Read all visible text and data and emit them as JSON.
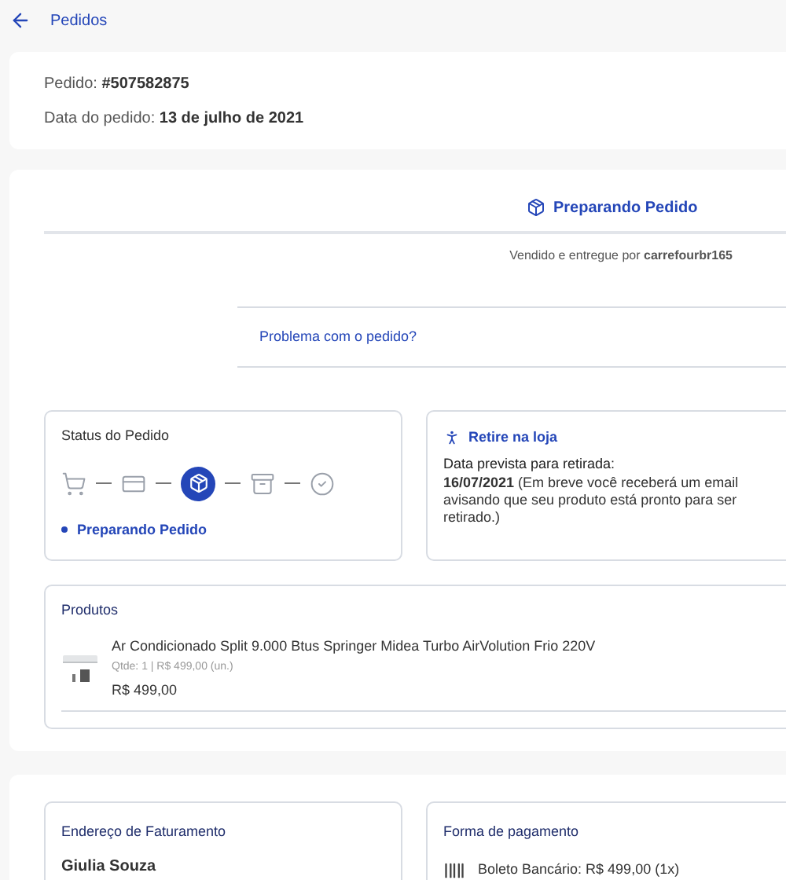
{
  "back_link": {
    "label": "Pedidos"
  },
  "order": {
    "number_label": "Pedido:",
    "number": "#507582875",
    "date_label": "Data do pedido:",
    "date": "13 de julho de 2021"
  },
  "shipment": {
    "status": "Preparando Pedido",
    "seller_text": "Vendido e entregue por **carrefourbr165**",
    "problem_link": "Problema com o pedido?"
  },
  "status_card": {
    "title": "Status do Pedido",
    "steps": [
      {
        "kind": "cart",
        "selected": false
      },
      {
        "kind": "payment",
        "selected": false
      },
      {
        "kind": "preparing",
        "selected": true
      },
      {
        "kind": "shipping",
        "selected": false
      },
      {
        "kind": "done",
        "selected": false
      }
    ],
    "current": "Preparando Pedido"
  },
  "pickup_card": {
    "title": "Retire na loja",
    "label": "Data prevista para retirada:",
    "text": "**16/07/2021** (Em breve você receberá um email avisando que seu produto está pronto para ser retirado.)"
  },
  "products": {
    "title": "Produtos",
    "items": [
      {
        "name": "Ar Condicionado Split 9.000 Btus Springer Midea Turbo AirVolution Frio 220V",
        "qty": "Qtde: 1 | R$ 499,00 (un.)",
        "price": "R$ 499,00"
      }
    ]
  },
  "billing": {
    "title": "Endereço de Faturamento",
    "name": "Giulia Souza"
  },
  "payment": {
    "title": "Forma de pagamento",
    "method": "Boleto Bancário: R$ 499,00 (1x)"
  }
}
